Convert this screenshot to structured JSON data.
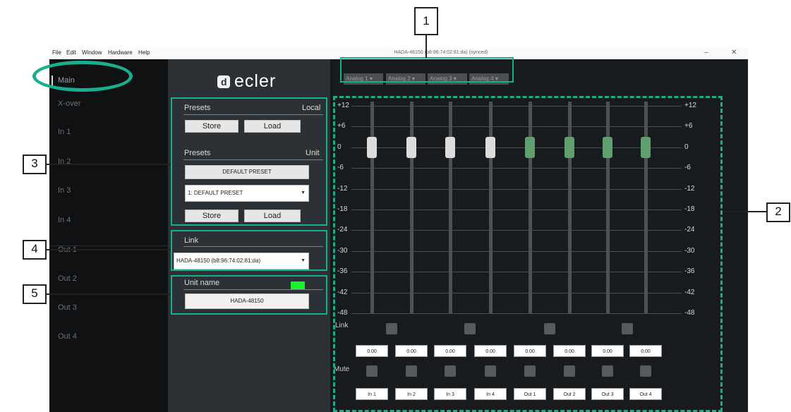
{
  "menu": [
    "File",
    "Edit",
    "Window",
    "Hardware",
    "Help"
  ],
  "window_title": "HADA-48150 (b8:96:74:02:81:da) (synced)",
  "window_controls": {
    "minimize": "–",
    "close": "✕"
  },
  "sidebar": {
    "items": [
      {
        "label": "Main"
      },
      {
        "label": "X-over"
      },
      {
        "label": "In 1"
      },
      {
        "label": "In 2"
      },
      {
        "label": "In 3"
      },
      {
        "label": "In 4"
      },
      {
        "label": "Out 1"
      },
      {
        "label": "Out 2"
      },
      {
        "label": "Out 3"
      },
      {
        "label": "Out 4"
      }
    ]
  },
  "logo": {
    "mark": "d",
    "text": "ecler"
  },
  "presets_local": {
    "title": "Presets",
    "scope": "Local",
    "store": "Store",
    "load": "Load"
  },
  "presets_unit": {
    "title": "Presets",
    "scope": "Unit",
    "default_button": "DEFAULT PRESET",
    "selected": "1: DEFAULT PRESET",
    "store": "Store",
    "load": "Load"
  },
  "link": {
    "title": "Link",
    "selected": "HADA-48150 (b8:96:74:02:81:da)",
    "status_color": "#1cf22c"
  },
  "unit_name": {
    "title": "Unit name",
    "value": "HADA-48150"
  },
  "tabs": [
    "Analog 1",
    "Analog 2",
    "Analog 3",
    "Analog 4"
  ],
  "scale": [
    "+12",
    "+6",
    "0",
    "-6",
    "-12",
    "-18",
    "-24",
    "-30",
    "-36",
    "-42",
    "-48"
  ],
  "mixer": {
    "link_label": "Link",
    "mute_label": "Mute",
    "channels": [
      {
        "label": "In 1",
        "gain": "0.00",
        "type": "in"
      },
      {
        "label": "In 2",
        "gain": "0.00",
        "type": "in"
      },
      {
        "label": "In 3",
        "gain": "0.00",
        "type": "in"
      },
      {
        "label": "In 4",
        "gain": "0.00",
        "type": "in"
      },
      {
        "label": "Out 1",
        "gain": "0.00",
        "type": "out"
      },
      {
        "label": "Out 2",
        "gain": "0.00",
        "type": "out"
      },
      {
        "label": "Out 3",
        "gain": "0.00",
        "type": "out"
      },
      {
        "label": "Out 4",
        "gain": "0.00",
        "type": "out"
      }
    ]
  },
  "callouts": [
    "1",
    "2",
    "3",
    "4",
    "5"
  ],
  "colors": {
    "annotation": "#1aae8f",
    "out_fader": "#5f9e6e",
    "in_fader": "#dcdcdc"
  }
}
